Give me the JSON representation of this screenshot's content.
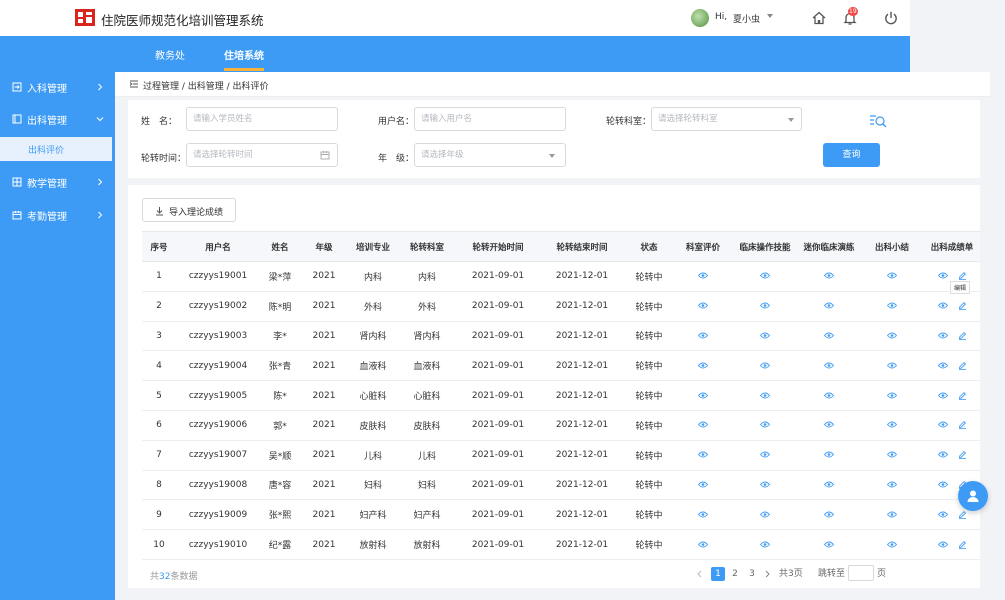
{
  "header": {
    "title": "住院医师规范化培训管理系统",
    "greeting": "Hi,",
    "user_name": "夏小虫",
    "notification_count": "19"
  },
  "nav": {
    "tabs": [
      {
        "label": "教务处"
      },
      {
        "label": "住培系统"
      }
    ]
  },
  "sidebar": {
    "items": [
      {
        "label": "入科管理"
      },
      {
        "label": "出科管理"
      },
      {
        "label": "出科评价"
      },
      {
        "label": "教学管理"
      },
      {
        "label": "考勤管理"
      }
    ]
  },
  "breadcrumb": "过程管理 / 出科管理 / 出科评价",
  "filters": {
    "name_label": "姓　名：",
    "name_placeholder": "请输入学员姓名",
    "username_label": "用户名：",
    "username_placeholder": "请输入用户名",
    "dept_label": "轮转科室：",
    "dept_placeholder": "请选择轮转科室",
    "time_label": "轮转时间：",
    "time_placeholder": "请选择轮转时间",
    "grade_label": "年　级：",
    "grade_placeholder": "请选择年级",
    "search_label": "查询"
  },
  "toolbar": {
    "import_label": "导入理论成绩"
  },
  "table": {
    "headers": [
      "序号",
      "用户名",
      "姓名",
      "年级",
      "培训专业",
      "轮转科室",
      "轮转开始时间",
      "轮转结束时间",
      "状态",
      "科室评价",
      "临床操作技能",
      "迷你临床演练",
      "出科小结",
      "出科成绩单"
    ],
    "rows": [
      [
        "1",
        "czzyys19001",
        "梁*萍",
        "2021",
        "内科",
        "内科",
        "2021-09-01",
        "2021-12-01",
        "轮转中"
      ],
      [
        "2",
        "czzyys19002",
        "陈*明",
        "2021",
        "外科",
        "外科",
        "2021-09-01",
        "2021-12-01",
        "轮转中"
      ],
      [
        "3",
        "czzyys19003",
        "李*",
        "2021",
        "肾内科",
        "肾内科",
        "2021-09-01",
        "2021-12-01",
        "轮转中"
      ],
      [
        "4",
        "czzyys19004",
        "张*青",
        "2021",
        "血液科",
        "血液科",
        "2021-09-01",
        "2021-12-01",
        "轮转中"
      ],
      [
        "5",
        "czzyys19005",
        "陈*",
        "2021",
        "心脏科",
        "心脏科",
        "2021-09-01",
        "2021-12-01",
        "轮转中"
      ],
      [
        "6",
        "czzyys19006",
        "郭*",
        "2021",
        "皮肤科",
        "皮肤科",
        "2021-09-01",
        "2021-12-01",
        "轮转中"
      ],
      [
        "7",
        "czzyys19007",
        "吴*顺",
        "2021",
        "儿科",
        "儿科",
        "2021-09-01",
        "2021-12-01",
        "轮转中"
      ],
      [
        "8",
        "czzyys19008",
        "唐*容",
        "2021",
        "妇科",
        "妇科",
        "2021-09-01",
        "2021-12-01",
        "轮转中"
      ],
      [
        "9",
        "czzyys19009",
        "张*熙",
        "2021",
        "妇产科",
        "妇产科",
        "2021-09-01",
        "2021-12-01",
        "轮转中"
      ],
      [
        "10",
        "czzyys19010",
        "纪*露",
        "2021",
        "放射科",
        "放射科",
        "2021-09-01",
        "2021-12-01",
        "轮转中"
      ]
    ],
    "edit_tooltip": "编辑"
  },
  "pagination": {
    "total_prefix": "共",
    "total_count": "32",
    "total_suffix": "条数据",
    "pages": [
      "1",
      "2",
      "3"
    ],
    "current_page": "1",
    "page_count": "共3页",
    "jump_label": "跳转至",
    "page_unit": "页"
  },
  "colors": {
    "primary": "#3d9bf5",
    "accent": "#f7b33a",
    "badge": "#f24b4b"
  }
}
